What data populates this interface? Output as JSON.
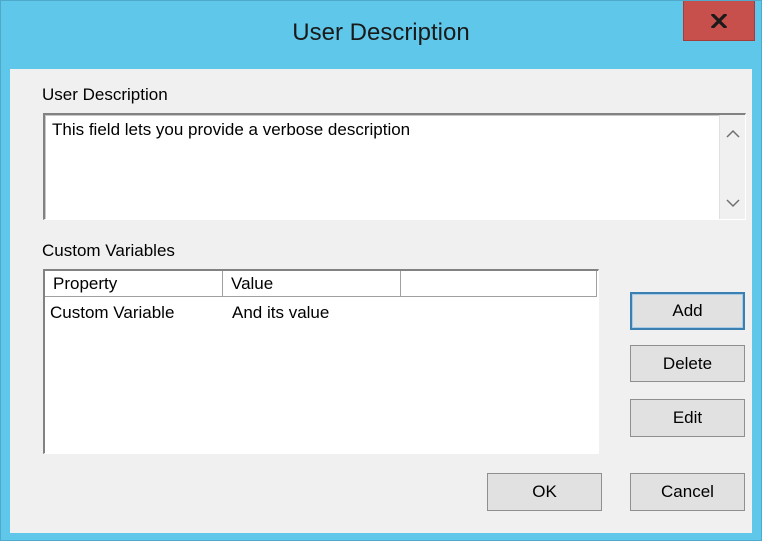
{
  "window": {
    "title": "User Description"
  },
  "close_icon": "close-icon",
  "description": {
    "label": "User Description",
    "value": "This field lets you provide a verbose description"
  },
  "custom_variables": {
    "label": "Custom Variables",
    "columns": [
      "Property",
      "Value",
      ""
    ],
    "rows": [
      {
        "property": "Custom Variable",
        "value": "And its value"
      }
    ]
  },
  "buttons": {
    "add": "Add",
    "delete": "Delete",
    "edit": "Edit",
    "ok": "OK",
    "cancel": "Cancel"
  }
}
